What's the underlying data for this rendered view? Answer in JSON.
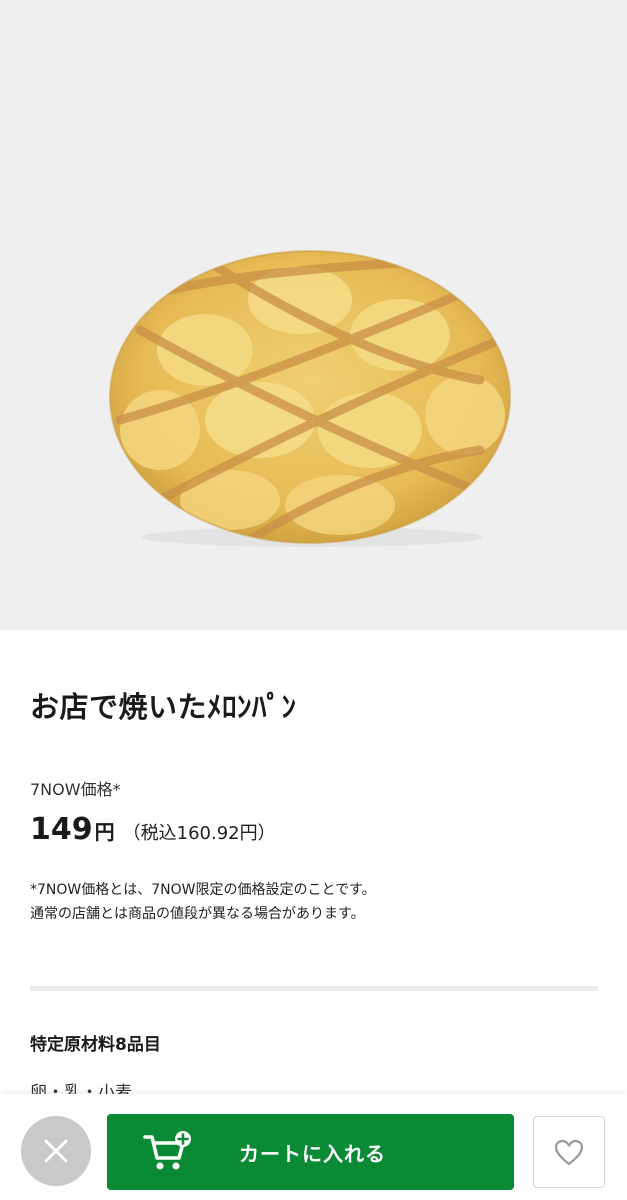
{
  "product": {
    "image_alt": "メロンパン",
    "title": "お店で焼いたﾒﾛﾝﾊﾟﾝ",
    "price_label": "7NOW価格*",
    "price_value": "149",
    "price_currency": "円",
    "price_tax": "（税込160.92円）",
    "note_line1": "*7NOW価格とは、7NOW限定の価格設定のことです。",
    "note_line2": "通常の店舗とは商品の値段が異なる場合があります。"
  },
  "allergens": {
    "heading": "特定原材料8品目",
    "values": "卵・乳・小麦"
  },
  "actions": {
    "close_icon": "close-icon",
    "cart_icon": "cart-add-icon",
    "cart_label": "カートに入れる",
    "favorite_icon": "heart-icon"
  },
  "colors": {
    "accent": "#0b8a35",
    "image_background": "#efefef",
    "close_button": "#c9c9c9"
  }
}
